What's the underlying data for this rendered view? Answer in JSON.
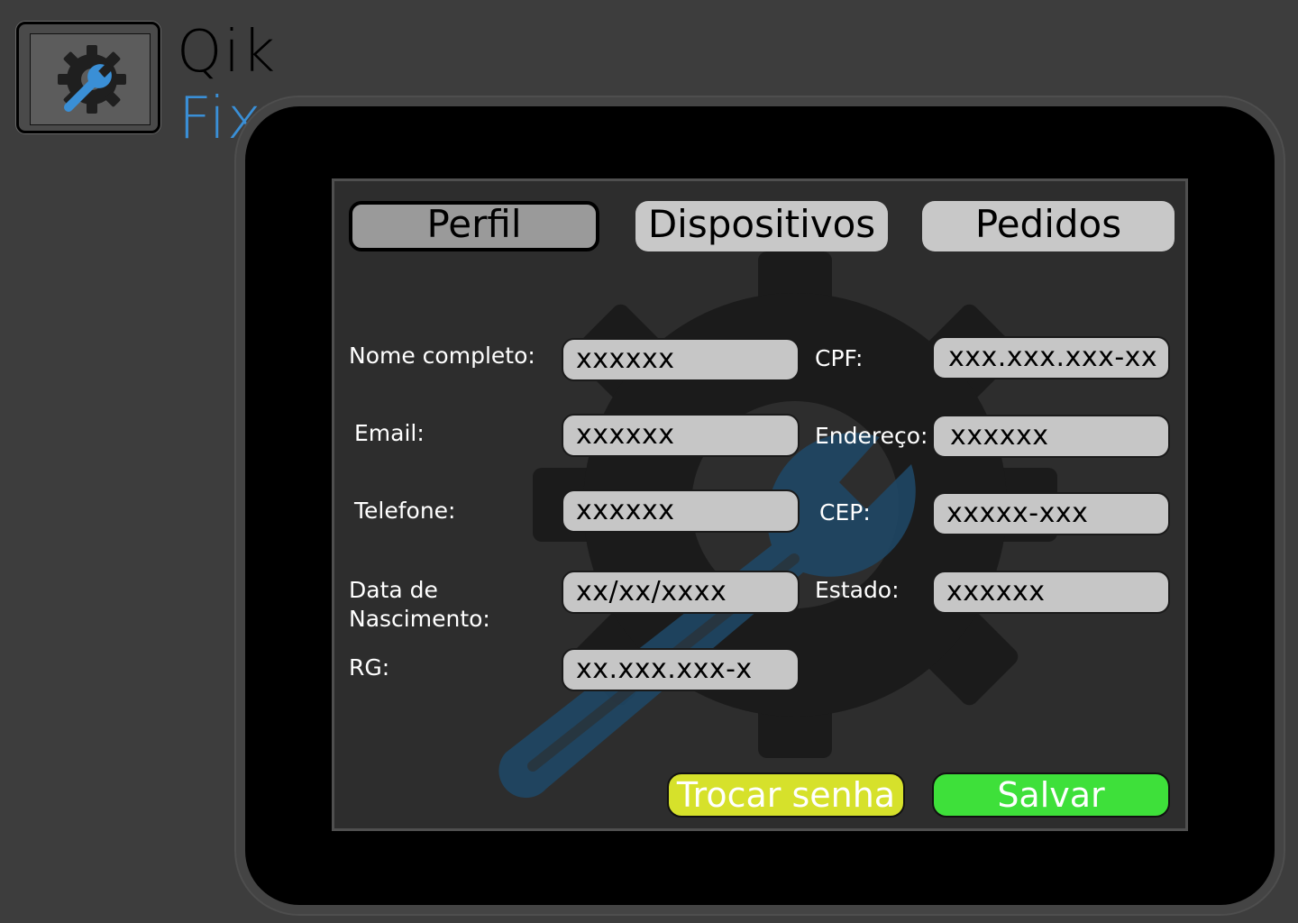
{
  "brand": {
    "line1": "Qik",
    "line2": "Fix",
    "logo_icon": "gear-wrench-icon",
    "accent_color": "#3a8fd6"
  },
  "tabs": [
    {
      "label": "Perfil",
      "active": true
    },
    {
      "label": "Dispositivos",
      "active": false
    },
    {
      "label": "Pedidos",
      "active": false
    }
  ],
  "form": {
    "nome": {
      "label": "Nome completo:",
      "value": "xxxxxx"
    },
    "email": {
      "label": "Email:",
      "value": "xxxxxx"
    },
    "telefone": {
      "label": "Telefone:",
      "value": "xxxxxx"
    },
    "nascimento": {
      "label_line1": "Data de",
      "label_line2": "Nascimento:",
      "value": "xx/xx/xxxx"
    },
    "rg": {
      "label": "RG:",
      "value": "xx.xxx.xxx-x"
    },
    "cpf": {
      "label": "CPF:",
      "value": "xxx.xxx.xxx-xx"
    },
    "endereco": {
      "label": "Endereço:",
      "value": "xxxxxx"
    },
    "cep": {
      "label": "CEP:",
      "value": "xxxxx-xxx"
    },
    "estado": {
      "label": "Estado:",
      "value": "xxxxxx"
    }
  },
  "actions": {
    "trocar_senha": {
      "label": "Trocar senha",
      "color": "#d6e12b"
    },
    "salvar": {
      "label": "Salvar",
      "color": "#3ee03a"
    }
  }
}
